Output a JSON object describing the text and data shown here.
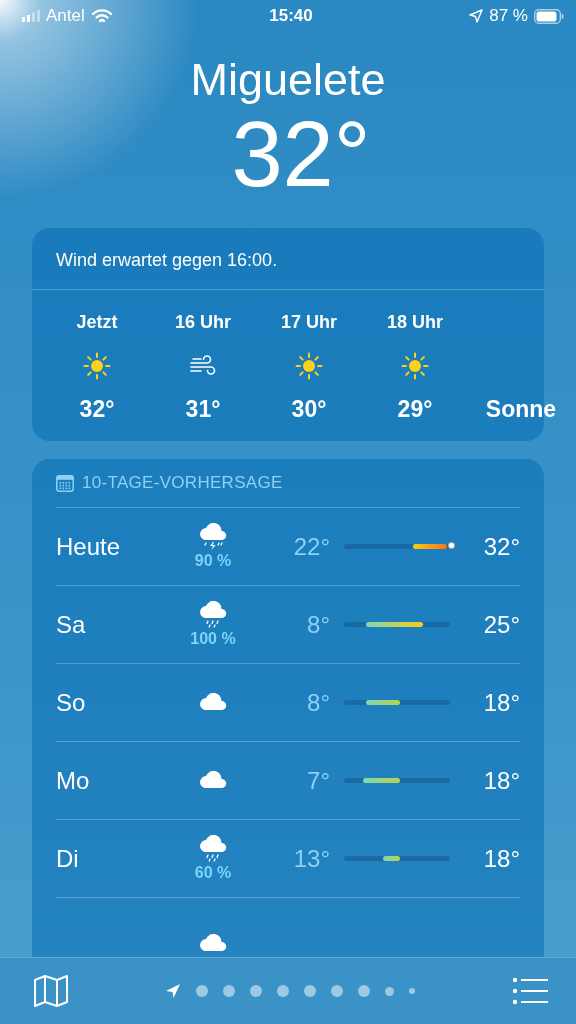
{
  "status_bar": {
    "carrier": "Antel",
    "time": "15:40",
    "battery": "87 %"
  },
  "location": {
    "city": "Miguelete",
    "temperature": "32°"
  },
  "hourly": {
    "summary": "Wind erwartet gegen 16:00.",
    "items": [
      {
        "kind": "sun",
        "time": "Jetzt",
        "temp": "32°"
      },
      {
        "kind": "wind",
        "time": "16 Uhr",
        "temp": "31°"
      },
      {
        "kind": "sun",
        "time": "17 Uhr",
        "temp": "30°"
      },
      {
        "kind": "sun",
        "time": "18 Uhr",
        "temp": "29°"
      },
      {
        "kind": "text",
        "temp": "Sonne"
      }
    ]
  },
  "forecast": {
    "title": "10-TAGE-VORHERSAGE",
    "days": [
      {
        "day": "Heute",
        "kind": "thunder",
        "precip": "90 %",
        "low": "22°",
        "high": "32°",
        "current": true
      },
      {
        "day": "Sa",
        "kind": "rain",
        "precip": "100 %",
        "low": "8°",
        "high": "25°",
        "current": false
      },
      {
        "day": "So",
        "kind": "cloud",
        "low": "8°",
        "high": "18°",
        "current": false
      },
      {
        "day": "Mo",
        "kind": "cloud",
        "low": "7°",
        "high": "18°",
        "current": false
      },
      {
        "day": "Di",
        "kind": "rain",
        "precip": "60 %",
        "low": "13°",
        "high": "18°",
        "current": false
      }
    ],
    "peek": {
      "kind": "cloud"
    }
  },
  "pages": [
    {
      "kind": "location",
      "selected": true
    },
    {
      "kind": "dot",
      "selected": false
    },
    {
      "kind": "dot",
      "selected": false
    },
    {
      "kind": "dot",
      "selected": false
    },
    {
      "kind": "dot",
      "selected": false
    },
    {
      "kind": "dot",
      "selected": false
    },
    {
      "kind": "dot",
      "selected": false
    },
    {
      "kind": "dot",
      "selected": false
    },
    {
      "kind": "dot",
      "selected": false
    },
    {
      "kind": "dot",
      "selected": false
    }
  ]
}
